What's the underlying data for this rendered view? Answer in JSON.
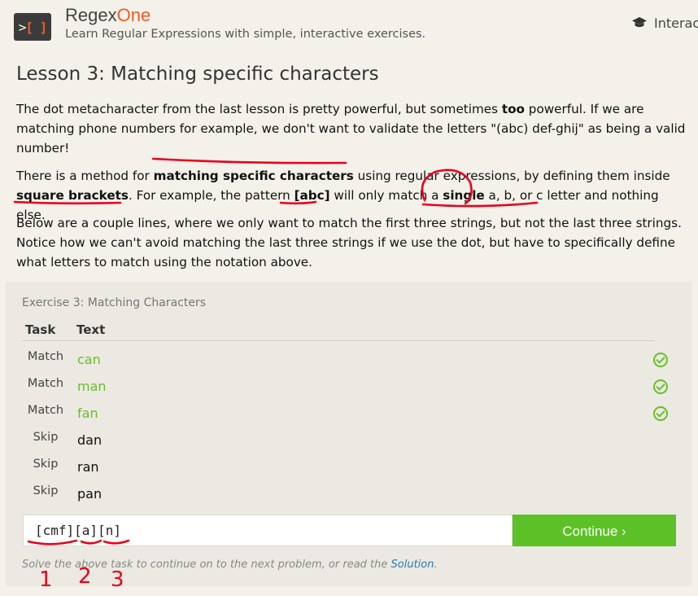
{
  "header": {
    "logo_text": "RegexOne",
    "brand_a": "Regex",
    "brand_b": "One",
    "tagline": "Learn Regular Expressions with simple, interactive exercises.",
    "nav_item": "Interac"
  },
  "lesson": {
    "title": "Lesson 3: Matching specific characters",
    "p1_a": "The dot metacharacter from the last lesson is pretty powerful, but sometimes ",
    "p1_b": "too",
    "p1_c": " powerful. If we are matching phone numbers for example, we don't want to validate the letters \"(abc) def-ghij\" as being a valid number!",
    "p2_a": "There is a method for ",
    "p2_b": "matching specific characters",
    "p2_c": " using regular expressions, by defining them inside ",
    "p2_d": "square brackets",
    "p2_e": ". For example, the pattern ",
    "p2_f": "[abc]",
    "p2_g": " will only match a ",
    "p2_h": "single",
    "p2_i": " a, b, or c letter and nothing else.",
    "p3": "Below are a couple lines, where we only want to match the first three strings, but not the last three strings. Notice how we can't avoid matching the last three strings if we use the dot, but have to specifically define what letters to match using the notation above."
  },
  "exercise": {
    "title": "Exercise 3: Matching Characters",
    "col_task": "Task",
    "col_text": "Text",
    "rows": [
      {
        "task": "Match",
        "text": "can",
        "status": "matched"
      },
      {
        "task": "Match",
        "text": "man",
        "status": "matched"
      },
      {
        "task": "Match",
        "text": "fan",
        "status": "matched"
      },
      {
        "task": "Skip",
        "text": "dan",
        "status": "skipped"
      },
      {
        "task": "Skip",
        "text": "ran",
        "status": "skipped"
      },
      {
        "task": "Skip",
        "text": "pan",
        "status": "skipped"
      }
    ],
    "input_value": "[cmf][a][n]",
    "continue_label": "Continue ›",
    "hint_a": "Solve the above task to continue on to the next problem, or read the ",
    "hint_link": "Solution",
    "hint_b": "."
  },
  "annotations": {
    "numbers": [
      "1",
      "2",
      "3"
    ]
  },
  "colors": {
    "accent": "#f05a28",
    "success": "#5cc126",
    "link": "#2a7ab8",
    "annotation": "#e8001c"
  },
  "icons": [
    "logo-icon",
    "graduation-cap-icon",
    "check-circle-icon"
  ]
}
